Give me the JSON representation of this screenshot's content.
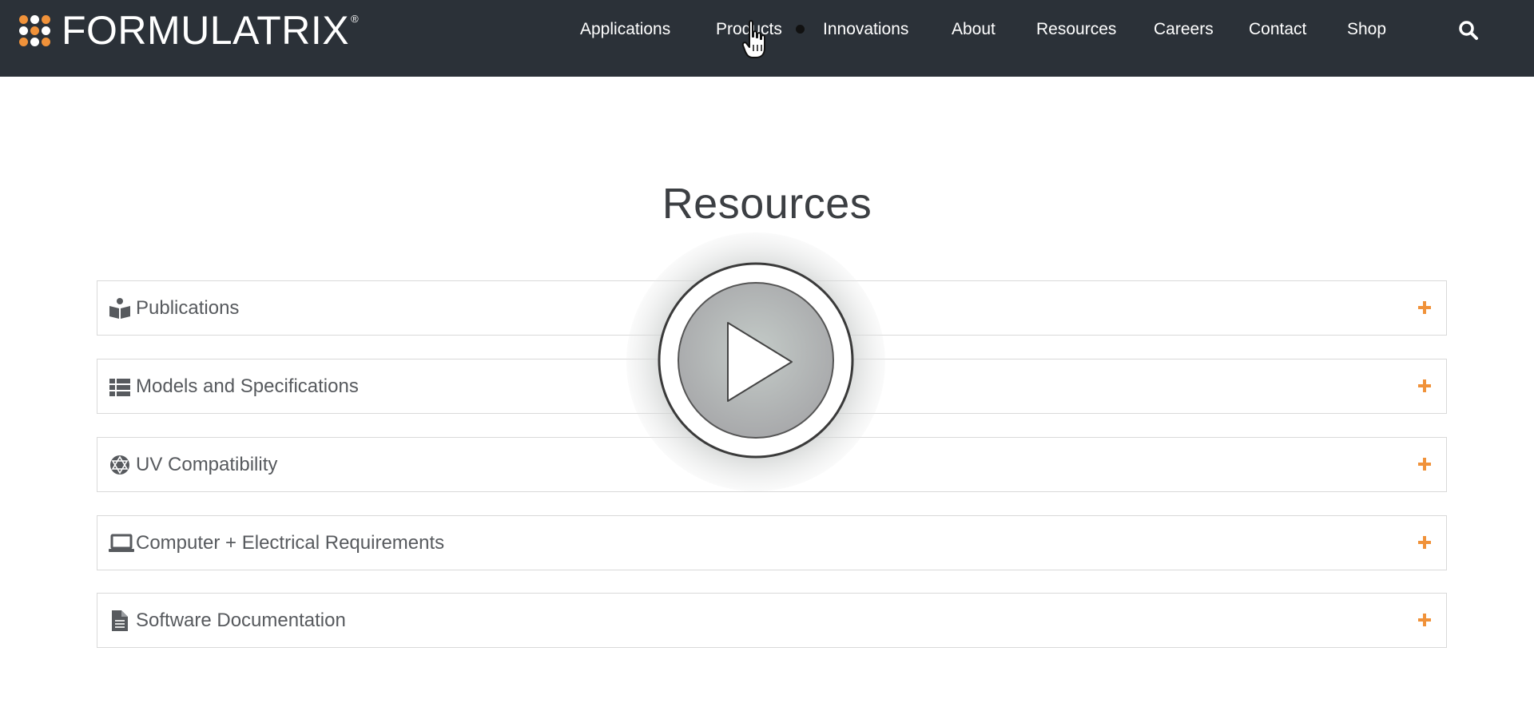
{
  "header": {
    "brand": "FORMULATRIX",
    "brand_mark": "®",
    "nav": [
      {
        "label": "Applications"
      },
      {
        "label": "Products"
      },
      {
        "label": "Innovations"
      },
      {
        "label": "About"
      },
      {
        "label": "Resources"
      },
      {
        "label": "Careers"
      },
      {
        "label": "Contact"
      },
      {
        "label": "Shop"
      }
    ],
    "search_icon": "search-icon"
  },
  "main": {
    "title": "Resources",
    "sections": [
      {
        "label": "Publications",
        "icon": "book-reader-icon"
      },
      {
        "label": "Models and Specifications",
        "icon": "list-icon"
      },
      {
        "label": "UV Compatibility",
        "icon": "atom-icon"
      },
      {
        "label": "Computer + Electrical Requirements",
        "icon": "laptop-icon"
      },
      {
        "label": "Software Documentation",
        "icon": "document-icon"
      }
    ]
  },
  "colors": {
    "header_bg": "#2b3138",
    "accent": "#f0923a",
    "text": "#575a5e"
  },
  "overlay": {
    "icon": "play-icon"
  }
}
